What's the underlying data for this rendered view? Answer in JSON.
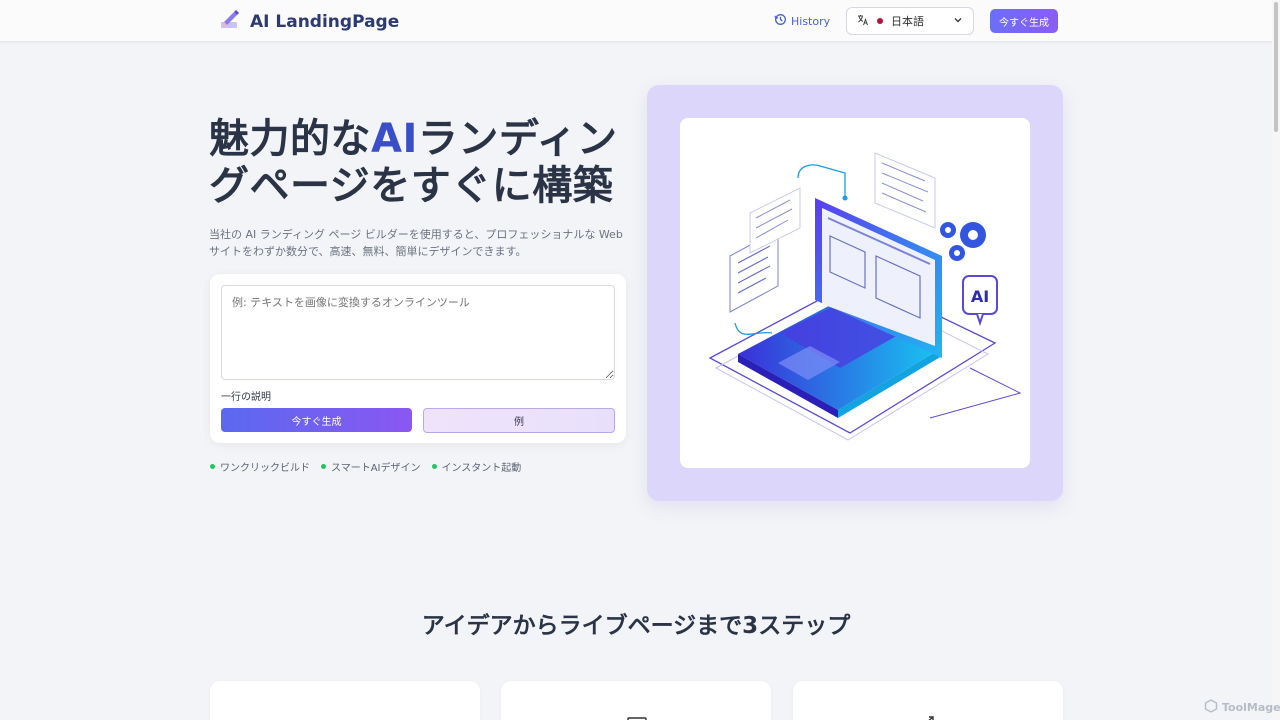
{
  "header": {
    "brand": "AI LandingPage",
    "history_label": "History",
    "language": "日本語",
    "cta_label": "今すぐ生成"
  },
  "hero": {
    "title_part1": "魅力的な",
    "title_accent": "AI",
    "title_part2": "ランディングページをすぐに構築",
    "subtitle": "当社の AI ランディング ページ ビルダーを使用すると、プロフェッショナルな Web サイトをわずか数分で、高速、無料、簡単にデザインできます。"
  },
  "form": {
    "placeholder": "例: テキストを画像に変換するオンラインツール",
    "hint": "一行の説明",
    "generate_label": "今すぐ生成",
    "example_label": "例"
  },
  "features": [
    "ワンクリックビルド",
    "スマートAIデザイン",
    "インスタント起動"
  ],
  "illustration": {
    "ai_badge": "AI"
  },
  "steps": {
    "title": "アイデアからライブページまで3ステップ"
  },
  "watermark": "ToolMage",
  "colors": {
    "accent": "#3a4fc7",
    "button_gradient_start": "#5a69f0",
    "button_gradient_end": "#8a57f2",
    "feature_dot": "#22c55e",
    "illustration_bg": "#ddd6fb"
  }
}
